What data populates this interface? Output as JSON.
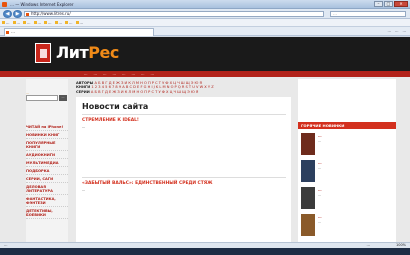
{
  "browser": {
    "title": "… — Windows Internet Explorer",
    "address": "http://www.litres.ru/",
    "search_placeholder": "…",
    "tab_title": "…",
    "favorites": [
      "…",
      "…",
      "…",
      "…",
      "…",
      "…",
      "…",
      "…"
    ],
    "tools": [
      "…",
      "…",
      "…"
    ],
    "status": "…",
    "zone": "…",
    "zoom": "100%"
  },
  "site": {
    "logo_main": "Лит",
    "logo_accent": "Рес",
    "nav": [
      "…",
      "…",
      "…",
      "…",
      "…",
      "…",
      "…",
      "…"
    ]
  },
  "sidebar": {
    "search_label": "…",
    "search_button": "…",
    "menu": [
      "ЧИТАЙ на iPhone!",
      "НОВИНКИ КНИГ",
      "ПОПУЛЯРНЫЕ КНИГИ",
      "АУДИОКНИГИ",
      "МУЛЬТИМЕДИА",
      "ПОДБОРКА",
      "СЕРИИ, САГИ",
      "ДЕЛОВАЯ ЛИТЕРАТУРА",
      "ФАНТАСТИКА, ФЭНТЕЗИ",
      "ДЕТЕКТИВЫ, БОЕВИКИ"
    ]
  },
  "alphabet": {
    "authors_label": "АВТОРЫ",
    "books_label": "КНИГИ",
    "series_label": "СЕРИИ",
    "letters": "А Б В Г Д Е Ж З И К Л М Н О П Р С Т У Ф Х Ц Ч Ш Щ Э Ю Я",
    "digits": "1 2 3 4 5 6 7 8 9 A B C D E F G H I J K L M N O P Q R S T U V W X Y Z"
  },
  "content": {
    "title": "Новости сайта",
    "news": [
      {
        "heading": "СТРЕМЛЕНИЕ К IDEAL!",
        "text": "…"
      },
      {
        "heading": "«ЗАБЫТЫЙ ВАЛЬС»: ЕДИНСТВЕННЫЙ СРЕДИ СТЯЖ",
        "text": "…"
      }
    ]
  },
  "right": {
    "header": "ГОРЯЧИЕ НОВИНКИ",
    "books": [
      {
        "title": "…",
        "author": "…",
        "color": "#6e2b1c"
      },
      {
        "title": "…",
        "author": "…",
        "color": "#2c3f5e"
      },
      {
        "title": "…",
        "author": "…",
        "color": "#3b3b3b"
      },
      {
        "title": "…",
        "author": "…",
        "color": "#8a5a2a"
      }
    ]
  }
}
